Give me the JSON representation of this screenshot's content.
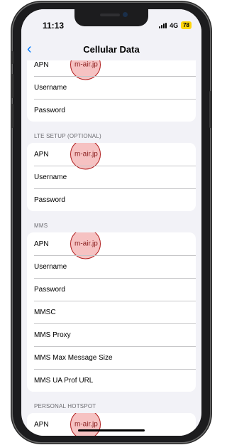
{
  "status_bar": {
    "time": "11:13",
    "network": "4G",
    "battery": "78"
  },
  "nav": {
    "title": "Cellular Data"
  },
  "sections": [
    {
      "header": "",
      "rows": [
        {
          "label": "APN",
          "value": "m-air.jp",
          "highlighted": true
        },
        {
          "label": "Username",
          "value": ""
        },
        {
          "label": "Password",
          "value": ""
        }
      ]
    },
    {
      "header": "LTE SETUP (OPTIONAL)",
      "rows": [
        {
          "label": "APN",
          "value": "m-air.jp",
          "highlighted": true
        },
        {
          "label": "Username",
          "value": ""
        },
        {
          "label": "Password",
          "value": ""
        }
      ]
    },
    {
      "header": "MMS",
      "rows": [
        {
          "label": "APN",
          "value": "m-air.jp",
          "highlighted": true
        },
        {
          "label": "Username",
          "value": ""
        },
        {
          "label": "Password",
          "value": ""
        },
        {
          "label": "MMSC",
          "value": ""
        },
        {
          "label": "MMS Proxy",
          "value": ""
        },
        {
          "label": "MMS Max Message Size",
          "value": ""
        },
        {
          "label": "MMS UA Prof URL",
          "value": ""
        }
      ]
    },
    {
      "header": "PERSONAL HOTSPOT",
      "rows": [
        {
          "label": "APN",
          "value": "m-air.jp",
          "highlighted": true
        }
      ]
    }
  ],
  "colors": {
    "accent": "#007aff",
    "battery": "#ffd60a",
    "marker": "#b01e1e"
  }
}
